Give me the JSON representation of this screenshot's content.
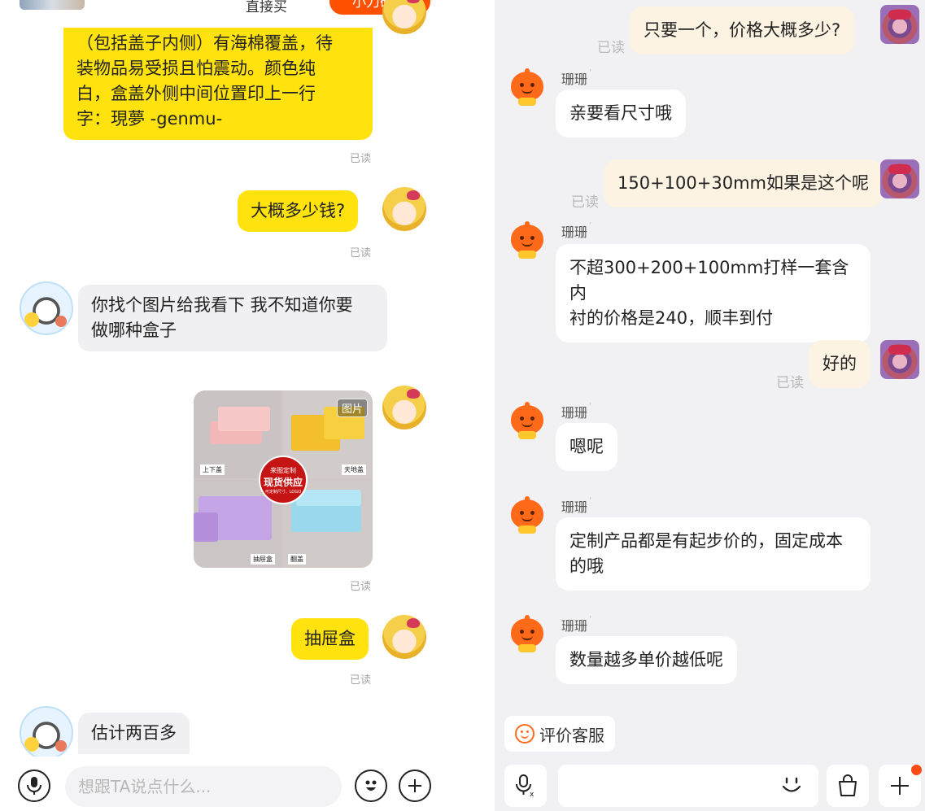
{
  "left_chat": {
    "top_bar": {
      "text": "直接买",
      "button": "小刀砍买"
    },
    "messages": [
      {
        "id": "m1",
        "side": "self",
        "lines": [
          "（包括盖子内侧）有海棉覆盖，待",
          "装物品易受损且怕震动。颜色纯",
          "白，盒盖外侧中间位置印上一行",
          "字：現夢 -genmu-"
        ],
        "status": "已读"
      },
      {
        "id": "m2",
        "side": "self",
        "text": "大概多少钱?",
        "status": "已读"
      },
      {
        "id": "m3",
        "side": "other",
        "lines": [
          "你找个图片给我看下 我不知道你要",
          "做哪种盒子"
        ]
      },
      {
        "id": "m4",
        "side": "self",
        "type": "image",
        "status": "已读",
        "image": {
          "badge": "图片",
          "tags": [
            "上下盖",
            "天地盖",
            "抽屉盒",
            "翻盖"
          ],
          "seal": {
            "line1": "来图定制",
            "line2": "现货供应",
            "line3": "可定制尺寸、LOGO"
          }
        }
      },
      {
        "id": "m5",
        "side": "self",
        "text": "抽屉盒",
        "status": "已读"
      },
      {
        "id": "m6",
        "side": "other",
        "text": "估计两百多"
      }
    ],
    "input": {
      "placeholder": "想跟TA说点什么..."
    },
    "icons": {
      "mic": "microphone-icon",
      "emoji": "emoji-icon",
      "plus": "plus-circle-icon"
    }
  },
  "right_chat": {
    "agent_name": "珊珊",
    "messages": [
      {
        "id": "r1",
        "side": "self",
        "text": "只要一个，价格大概多少?",
        "status": "已读"
      },
      {
        "id": "r2",
        "side": "agent",
        "text": "亲要看尺寸哦"
      },
      {
        "id": "r3",
        "side": "self",
        "text": "150+100+30mm如果是这个呢",
        "status": "已读"
      },
      {
        "id": "r4",
        "side": "agent",
        "lines": [
          "不超300+200+100mm打样一套含内",
          "衬的价格是240，顺丰到付"
        ]
      },
      {
        "id": "r5",
        "side": "self",
        "text": "好的",
        "status": "已读"
      },
      {
        "id": "r6",
        "side": "agent",
        "text": "嗯呢"
      },
      {
        "id": "r7",
        "side": "agent",
        "lines": [
          "定制产品都是有起步价的，固定成本",
          "的哦"
        ]
      },
      {
        "id": "r8",
        "side": "agent",
        "text": "数量越多单价越低呢"
      }
    ],
    "eval_button": "评价客服",
    "icons": {
      "voice": "voice-translate-icon",
      "emoji": "smile-icon",
      "bag": "shopping-bag-icon",
      "plus": "plus-icon"
    },
    "colors": {
      "accent": "#ff6a1a",
      "self_bubble": "#fdf3e3",
      "notification_dot": "#ff4b14"
    }
  },
  "colors": {
    "left_self_bubble": "#ffe20e",
    "left_other_bubble": "#f0f0f2",
    "top_button": "#ff5000"
  }
}
